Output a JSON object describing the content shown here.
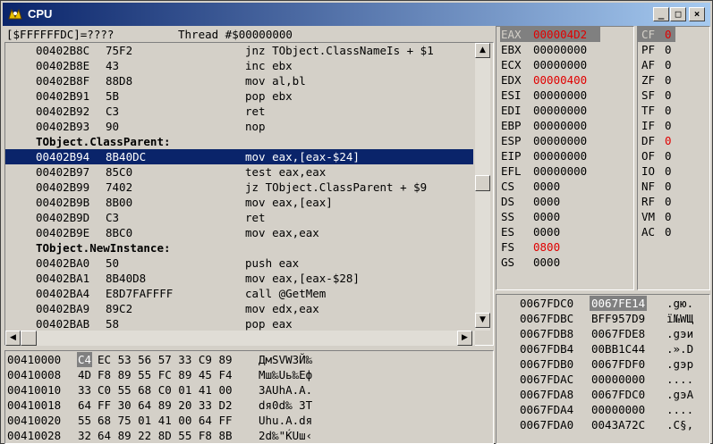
{
  "window": {
    "title": "CPU"
  },
  "header": {
    "address": "[$FFFFFFDC]=????",
    "thread": "Thread #$00000000"
  },
  "disasm": [
    {
      "addr": "00402B8C",
      "bytes": "75F2",
      "asm": "jnz TObject.ClassNameIs + $1",
      "type": "code"
    },
    {
      "addr": "00402B8E",
      "bytes": "43",
      "asm": "inc ebx",
      "type": "code"
    },
    {
      "addr": "00402B8F",
      "bytes": "88D8",
      "asm": "mov al,bl",
      "type": "code"
    },
    {
      "addr": "00402B91",
      "bytes": "5B",
      "asm": "pop ebx",
      "type": "code"
    },
    {
      "addr": "00402B92",
      "bytes": "C3",
      "asm": "ret",
      "type": "code"
    },
    {
      "addr": "00402B93",
      "bytes": "90",
      "asm": "nop",
      "type": "code"
    },
    {
      "label": "TObject.ClassParent:",
      "type": "label"
    },
    {
      "addr": "00402B94",
      "bytes": "8B40DC",
      "asm": "mov eax,[eax-$24]",
      "type": "selected"
    },
    {
      "addr": "00402B97",
      "bytes": "85C0",
      "asm": "test eax,eax",
      "type": "code"
    },
    {
      "addr": "00402B99",
      "bytes": "7402",
      "asm": "jz TObject.ClassParent + $9",
      "type": "code"
    },
    {
      "addr": "00402B9B",
      "bytes": "8B00",
      "asm": "mov eax,[eax]",
      "type": "code"
    },
    {
      "addr": "00402B9D",
      "bytes": "C3",
      "asm": "ret",
      "type": "code"
    },
    {
      "addr": "00402B9E",
      "bytes": "8BC0",
      "asm": "mov eax,eax",
      "type": "code"
    },
    {
      "label": "TObject.NewInstance:",
      "type": "label"
    },
    {
      "addr": "00402BA0",
      "bytes": "50",
      "asm": "push eax",
      "type": "code"
    },
    {
      "addr": "00402BA1",
      "bytes": "8B40D8",
      "asm": "mov eax,[eax-$28]",
      "type": "code"
    },
    {
      "addr": "00402BA4",
      "bytes": "E8D7FAFFFF",
      "asm": "call @GetMem",
      "type": "code"
    },
    {
      "addr": "00402BA9",
      "bytes": "89C2",
      "asm": "mov edx,eax",
      "type": "code"
    },
    {
      "addr": "00402BAB",
      "bytes": "58",
      "asm": "pop eax",
      "type": "code"
    }
  ],
  "registers": [
    {
      "name": "EAX",
      "value": "000004D2",
      "state": "changed-selected"
    },
    {
      "name": "EBX",
      "value": "00000000",
      "state": ""
    },
    {
      "name": "ECX",
      "value": "00000000",
      "state": ""
    },
    {
      "name": "EDX",
      "value": "00000400",
      "state": "changed"
    },
    {
      "name": "ESI",
      "value": "00000000",
      "state": ""
    },
    {
      "name": "EDI",
      "value": "00000000",
      "state": ""
    },
    {
      "name": "EBP",
      "value": "00000000",
      "state": ""
    },
    {
      "name": "ESP",
      "value": "00000000",
      "state": ""
    },
    {
      "name": "EIP",
      "value": "00000000",
      "state": ""
    },
    {
      "name": "EFL",
      "value": "00000000",
      "state": ""
    },
    {
      "name": "CS",
      "value": "0000",
      "state": ""
    },
    {
      "name": "DS",
      "value": "0000",
      "state": ""
    },
    {
      "name": "SS",
      "value": "0000",
      "state": ""
    },
    {
      "name": "ES",
      "value": "0000",
      "state": ""
    },
    {
      "name": "FS",
      "value": "0800",
      "state": "changed"
    },
    {
      "name": "GS",
      "value": "0000",
      "state": ""
    }
  ],
  "flags": [
    {
      "name": "CF",
      "value": "0",
      "state": "changed-selected"
    },
    {
      "name": "PF",
      "value": "0",
      "state": ""
    },
    {
      "name": "AF",
      "value": "0",
      "state": ""
    },
    {
      "name": "ZF",
      "value": "0",
      "state": ""
    },
    {
      "name": "SF",
      "value": "0",
      "state": ""
    },
    {
      "name": "TF",
      "value": "0",
      "state": ""
    },
    {
      "name": "IF",
      "value": "0",
      "state": ""
    },
    {
      "name": "DF",
      "value": "0",
      "state": "changed"
    },
    {
      "name": "OF",
      "value": "0",
      "state": ""
    },
    {
      "name": "IO",
      "value": "0",
      "state": ""
    },
    {
      "name": "NF",
      "value": "0",
      "state": ""
    },
    {
      "name": "RF",
      "value": "0",
      "state": ""
    },
    {
      "name": "VM",
      "value": "0",
      "state": ""
    },
    {
      "name": "AC",
      "value": "0",
      "state": ""
    }
  ],
  "memdump": [
    {
      "addr": "00410000",
      "first": "C4",
      "bytes": "EC 53 56 57 33 C9 89",
      "ascii": "ДмSVW3Й‰"
    },
    {
      "addr": "00410008",
      "first": "4D",
      "bytes": "F8 89 55 FC 89 45 F4",
      "ascii": "Mш‰Uь‰Eф"
    },
    {
      "addr": "00410010",
      "first": "33",
      "bytes": "C0 55 68 C0 01 41 00",
      "ascii": "3АUhА.A."
    },
    {
      "addr": "00410018",
      "first": "64",
      "bytes": "FF 30 64 89 20 33 D2",
      "ascii": "dя0d‰ 3Т"
    },
    {
      "addr": "00410020",
      "first": "55",
      "bytes": "68 75 01 41 00 64 FF",
      "ascii": "Uhu.A.dя"
    },
    {
      "addr": "00410028",
      "first": "32",
      "bytes": "64 89 22 8D 55 F8 8B",
      "ascii": "2d‰\"ЌUш‹"
    }
  ],
  "stack": [
    {
      "addr": "0067FDC0",
      "value": "0067FE14",
      "ascii": ".gю.",
      "state": "selected"
    },
    {
      "addr": "0067FDBC",
      "value": "BFF957D9",
      "ascii": "ї№WЩ",
      "state": ""
    },
    {
      "addr": "0067FDB8",
      "value": "0067FDE8",
      "ascii": ".gэи",
      "state": ""
    },
    {
      "addr": "0067FDB4",
      "value": "00BB1C44",
      "ascii": ".».D",
      "state": ""
    },
    {
      "addr": "0067FDB0",
      "value": "0067FDF0",
      "ascii": ".gэр",
      "state": ""
    },
    {
      "addr": "0067FDAC",
      "value": "00000000",
      "ascii": "....",
      "state": ""
    },
    {
      "addr": "0067FDA8",
      "value": "0067FDC0",
      "ascii": ".gэА",
      "state": ""
    },
    {
      "addr": "0067FDA4",
      "value": "00000000",
      "ascii": "....",
      "state": ""
    },
    {
      "addr": "0067FDA0",
      "value": "0043A72C",
      "ascii": ".C§,",
      "state": ""
    }
  ],
  "colors": {
    "selection": "#0a246a",
    "changed": "#e00000",
    "highlight_bg": "#808080"
  },
  "icons": {
    "app": "delphi-helmet-icon",
    "minimize": "minimize-icon",
    "maximize": "maximize-icon",
    "close": "close-icon"
  }
}
